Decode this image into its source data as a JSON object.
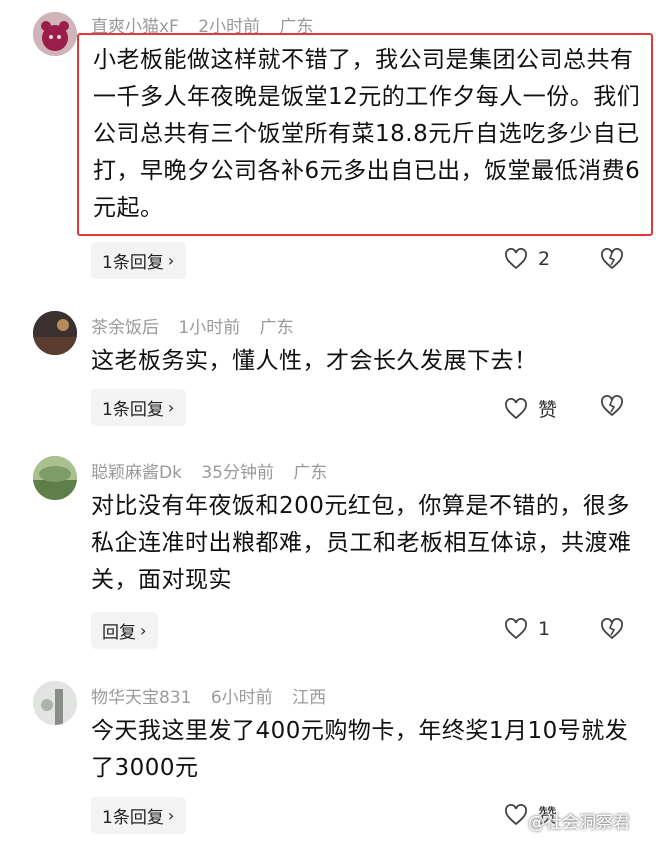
{
  "comments": [
    {
      "username": "直爽小猫xF",
      "time": "2小时前",
      "location": "广东",
      "text": "小老板能做这样就不错了，我公司是集团公司总共有一千多人年夜晚是饭堂12元的工作夕每人一份。我们公司总共有三个饭堂所有菜18.8元斤自选吃多少自已打，早晚夕公司各补6元多出自已出，饭堂最低消费6元起。",
      "reply_label": "1条回复",
      "likes": "2"
    },
    {
      "username": "茶余饭后",
      "time": "1小时前",
      "location": "广东",
      "text": "这老板务实，懂人性，才会长久发展下去！",
      "reply_label": "1条回复",
      "likes": "赞"
    },
    {
      "username": "聪颖麻酱Dk",
      "time": "35分钟前",
      "location": "广东",
      "text": "对比没有年夜饭和200元红包，你算是不错的，很多私企连准时出粮都难，员工和老板相互体谅，共渡难关，面对现实",
      "reply_label": "回复",
      "likes": "1"
    },
    {
      "username": "物华天宝831",
      "time": "6小时前",
      "location": "江西",
      "text": "今天我这里发了400元购物卡，年终奖1月10号就发了3000元",
      "reply_label": "1条回复",
      "likes": "赞"
    }
  ],
  "watermark": "@社会洞察君",
  "colors": {
    "highlight": "#e23a3a",
    "meta": "#9a9a9a",
    "button_bg": "#f3f3f3"
  }
}
